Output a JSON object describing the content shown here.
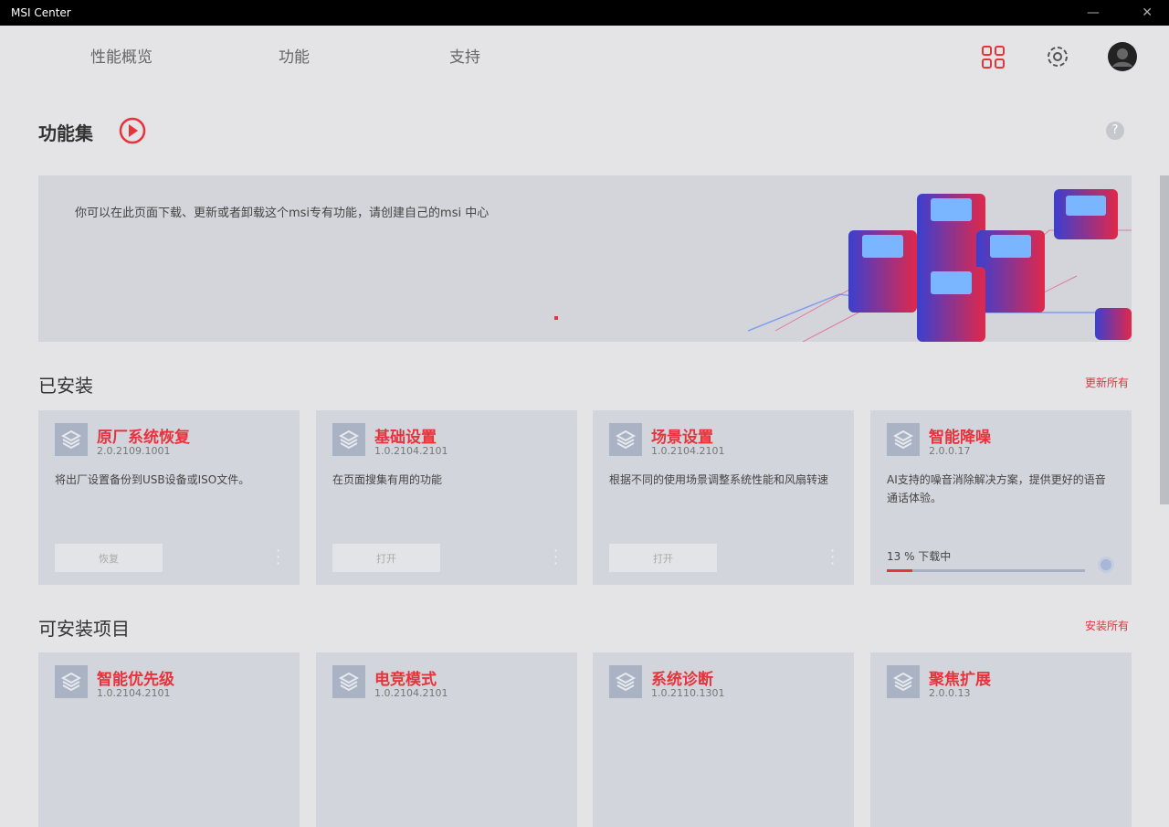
{
  "window": {
    "title": "MSI Center",
    "minimize": "—",
    "close": "✕"
  },
  "nav": {
    "tabs": [
      "性能概览",
      "功能",
      "支持"
    ]
  },
  "page": {
    "title": "功能集",
    "help": "?"
  },
  "banner": {
    "text": "你可以在此页面下载、更新或者卸载这个msi专有功能，请创建自己的msi 中心"
  },
  "installed": {
    "title": "已安装",
    "action": "更新所有",
    "cards": [
      {
        "name": "原厂系统恢复",
        "version": "2.0.2109.1001",
        "desc": "将出厂设置备份到USB设备或ISO文件。",
        "button": "恢复"
      },
      {
        "name": "基础设置",
        "version": "1.0.2104.2101",
        "desc": "在页面搜集有用的功能",
        "button": "打开"
      },
      {
        "name": "场景设置",
        "version": "1.0.2104.2101",
        "desc": "根据不同的使用场景调整系统性能和风扇转速",
        "button": "打开"
      },
      {
        "name": "智能降噪",
        "version": "2.0.0.17",
        "desc": "AI支持的噪音消除解决方案，提供更好的语音通话体验。",
        "progress_label": "13 % 下载中",
        "progress": 13
      }
    ]
  },
  "available": {
    "title": "可安装项目",
    "action": "安装所有",
    "cards": [
      {
        "name": "智能优先级",
        "version": "1.0.2104.2101"
      },
      {
        "name": "电竞模式",
        "version": "1.0.2104.2101"
      },
      {
        "name": "系统诊断",
        "version": "1.0.2110.1301"
      },
      {
        "name": "聚焦扩展",
        "version": "2.0.0.13"
      }
    ]
  },
  "colors": {
    "accent": "#e8323c"
  }
}
